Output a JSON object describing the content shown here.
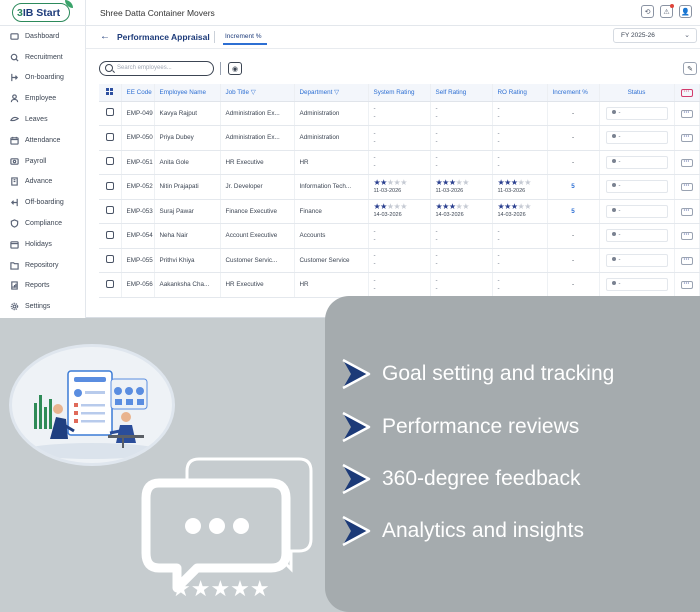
{
  "brand": {
    "logo_text": "3IB Start"
  },
  "header": {
    "company": "Shree Datta Container Movers"
  },
  "sidebar": {
    "items": [
      {
        "label": "Dashboard"
      },
      {
        "label": "Recruitment"
      },
      {
        "label": "On-boarding"
      },
      {
        "label": "Employee"
      },
      {
        "label": "Leaves"
      },
      {
        "label": "Attendance"
      },
      {
        "label": "Payroll"
      },
      {
        "label": "Advance"
      },
      {
        "label": "Off-boarding"
      },
      {
        "label": "Compliance"
      },
      {
        "label": "Holidays"
      },
      {
        "label": "Repository"
      },
      {
        "label": "Reports"
      },
      {
        "label": "Settings"
      }
    ]
  },
  "page": {
    "title": "Performance Appraisal",
    "tab": "Increment %",
    "fy_select": "FY 2025-26",
    "search_placeholder": "Search employees..."
  },
  "table": {
    "headers": [
      "EE Code",
      "Employee Name",
      "Job Title ▽",
      "Department ▽",
      "System Rating",
      "Self Rating",
      "RO Rating",
      "Increment %",
      "Status"
    ],
    "rows": [
      {
        "code": "EMP-049",
        "name": "Kavya Rajput",
        "job": "Administration Ex...",
        "dept": "Administration",
        "sys": "-",
        "self": "-",
        "ro": "-",
        "inc": "-",
        "status": "-"
      },
      {
        "code": "EMP-050",
        "name": "Priya Dubey",
        "job": "Administration Ex...",
        "dept": "Administration",
        "sys": "-",
        "self": "-",
        "ro": "-",
        "inc": "-",
        "status": "-"
      },
      {
        "code": "EMP-051",
        "name": "Anita Gole",
        "job": "HR Executive",
        "dept": "HR",
        "sys": "-",
        "self": "-",
        "ro": "-",
        "inc": "-",
        "status": "-"
      },
      {
        "code": "EMP-052",
        "name": "Nitin Prajapati",
        "job": "Jr. Developer",
        "dept": "Information Tech...",
        "sys_stars": 2,
        "sys_date": "11-03-2026",
        "self_stars": 3,
        "self_date": "11-03-2026",
        "ro_stars": 3,
        "ro_date": "11-03-2026",
        "inc": "5",
        "status": "-"
      },
      {
        "code": "EMP-053",
        "name": "Suraj Pawar",
        "job": "Finance Executive",
        "dept": "Finance",
        "sys_stars": 2,
        "sys_date": "14-03-2026",
        "self_stars": 3,
        "self_date": "14-03-2026",
        "ro_stars": 3,
        "ro_date": "14-03-2026",
        "inc": "5",
        "status": "-"
      },
      {
        "code": "EMP-054",
        "name": "Neha Nair",
        "job": "Account Executive",
        "dept": "Accounts",
        "sys": "-",
        "self": "-",
        "ro": "-",
        "inc": "-",
        "status": "-"
      },
      {
        "code": "EMP-055",
        "name": "Prithvi Khiya",
        "job": "Customer Servic...",
        "dept": "Customer Service",
        "sys": "-",
        "self": "-",
        "ro": "-",
        "inc": "-",
        "status": "-"
      },
      {
        "code": "EMP-056",
        "name": "Aakanksha Cha...",
        "job": "HR Executive",
        "dept": "HR",
        "sys": "-",
        "self": "-",
        "ro": "-",
        "inc": "-",
        "status": "-"
      }
    ]
  },
  "promo": {
    "features": [
      "Goal setting and tracking",
      "Performance reviews",
      "360-degree feedback",
      "Analytics and insights"
    ]
  },
  "colors": {
    "accent": "#2d6fd3",
    "brand_navy": "#1d3b7a",
    "brand_green": "#2c8a5c",
    "panel": "#a5abae",
    "background": "#c6cccf"
  }
}
